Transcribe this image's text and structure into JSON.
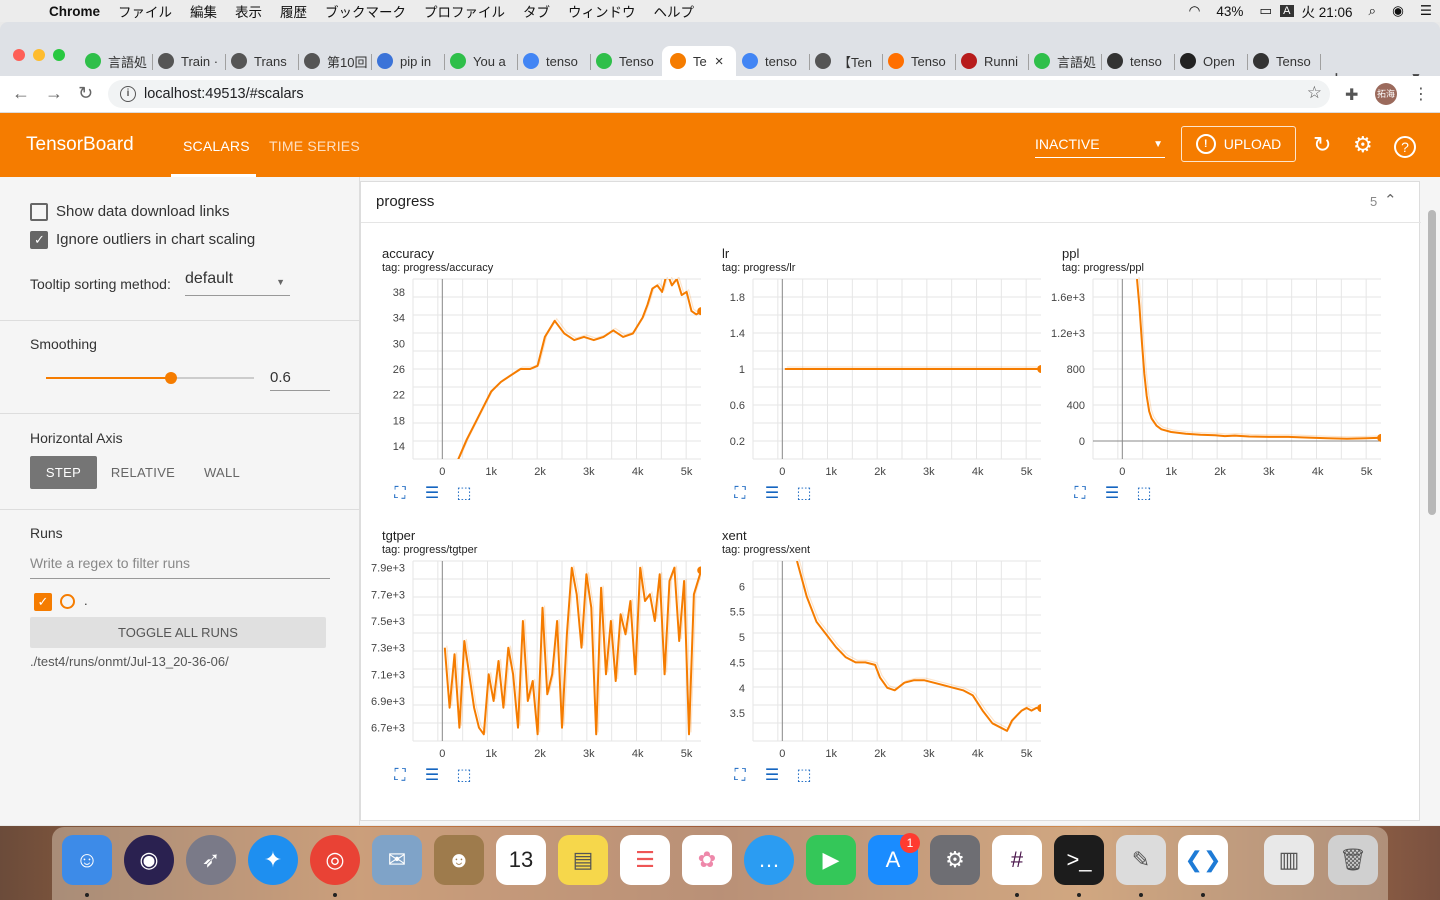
{
  "menubar": {
    "app": "Chrome",
    "items": [
      "ファイル",
      "編集",
      "表示",
      "履歴",
      "ブックマーク",
      "プロファイル",
      "タブ",
      "ウィンドウ",
      "ヘルプ"
    ],
    "battery": "43%",
    "input": "A",
    "clock": "火 21:06"
  },
  "tabs": [
    {
      "label": "言語処",
      "color": "#2fbf4a"
    },
    {
      "label": "Train ·",
      "color": "#555555"
    },
    {
      "label": "Trans",
      "color": "#555555"
    },
    {
      "label": "第10回",
      "color": "#555555"
    },
    {
      "label": "pip in",
      "color": "#3b73d8"
    },
    {
      "label": "You a",
      "color": "#2fbf4a"
    },
    {
      "label": "tenso",
      "color": "#4285f4"
    },
    {
      "label": "Tenso",
      "color": "#2fbf4a"
    },
    {
      "label": "Te",
      "color": "#f57c00",
      "active": true
    },
    {
      "label": "tenso",
      "color": "#4285f4"
    },
    {
      "label": "【Ten",
      "color": "#555555"
    },
    {
      "label": "Tenso",
      "color": "#ff6f00"
    },
    {
      "label": "Runni",
      "color": "#b71c1c"
    },
    {
      "label": "言語処",
      "color": "#2fbf4a"
    },
    {
      "label": "tenso",
      "color": "#333333"
    },
    {
      "label": "Open",
      "color": "#222222"
    },
    {
      "label": "Tenso",
      "color": "#333333"
    }
  ],
  "address": {
    "url": "localhost:49513/#scalars"
  },
  "profile": {
    "initials": "拓海"
  },
  "tensorboard": {
    "title": "TensorBoard",
    "nav": {
      "scalars": "SCALARS",
      "time_series": "TIME SERIES"
    },
    "inactive": "INACTIVE",
    "upload": "UPLOAD",
    "accent": "#f57c00"
  },
  "sidebar": {
    "show_download_links": "Show data download links",
    "ignore_outliers": "Ignore outliers in chart scaling",
    "tooltip_label": "Tooltip sorting method:",
    "tooltip_value": "default",
    "smoothing_label": "Smoothing",
    "smoothing_value": "0.6",
    "smoothing_fraction": 0.6,
    "horizontal_axis_label": "Horizontal Axis",
    "axis_step": "STEP",
    "axis_relative": "RELATIVE",
    "axis_wall": "WALL",
    "runs_label": "Runs",
    "runs_filter_placeholder": "Write a regex to filter runs",
    "run_name": ".",
    "toggle_all": "TOGGLE ALL RUNS",
    "run_path": "./test4/runs/onmt/Jul-13_20-36-06/"
  },
  "panel": {
    "title": "progress",
    "count": "5"
  },
  "chart_data": [
    {
      "type": "line",
      "name": "accuracy",
      "tag": "tag: progress/accuracy",
      "x_ticks": [
        "0",
        "1k",
        "2k",
        "3k",
        "4k",
        "5k"
      ],
      "x_tick_values": [
        0,
        1000,
        2000,
        3000,
        4000,
        5000
      ],
      "y_ticks": [
        "14",
        "18",
        "22",
        "26",
        "30",
        "34",
        "38"
      ],
      "y_tick_values": [
        14,
        18,
        22,
        26,
        30,
        34,
        38
      ],
      "xlim": [
        -600,
        5500
      ],
      "ylim": [
        12,
        40
      ],
      "grid": true,
      "x": [
        300,
        500,
        700,
        900,
        1000,
        1200,
        1400,
        1600,
        1800,
        1950,
        2100,
        2300,
        2500,
        2700,
        2900,
        3100,
        3300,
        3500,
        3700,
        3900,
        4100,
        4200,
        4300,
        4400,
        4500,
        4550,
        4600,
        4700,
        4800,
        4900,
        5000,
        5100,
        5200,
        5300
      ],
      "y": [
        11.5,
        15,
        18,
        21,
        22.5,
        24,
        25,
        26,
        26,
        26.5,
        31,
        33.5,
        31.5,
        30.5,
        31,
        30.5,
        31,
        32,
        31,
        31.5,
        34,
        36,
        38.5,
        39,
        38,
        39.5,
        41,
        39,
        40,
        37.5,
        38,
        35,
        34.5,
        35
      ]
    },
    {
      "type": "line",
      "name": "lr",
      "tag": "tag: progress/lr",
      "x_ticks": [
        "0",
        "1k",
        "2k",
        "3k",
        "4k",
        "5k"
      ],
      "x_tick_values": [
        0,
        1000,
        2000,
        3000,
        4000,
        5000
      ],
      "y_ticks": [
        "0.2",
        "0.6",
        "1",
        "1.4",
        "1.8"
      ],
      "y_tick_values": [
        0.2,
        0.6,
        1,
        1.4,
        1.8
      ],
      "xlim": [
        -600,
        5500
      ],
      "ylim": [
        0,
        2
      ],
      "grid": true,
      "x": [
        50,
        5300
      ],
      "y": [
        1,
        1
      ]
    },
    {
      "type": "line",
      "name": "ppl",
      "tag": "tag: progress/ppl",
      "x_ticks": [
        "0",
        "1k",
        "2k",
        "3k",
        "4k",
        "5k"
      ],
      "x_tick_values": [
        0,
        1000,
        2000,
        3000,
        4000,
        5000
      ],
      "y_ticks": [
        "0",
        "400",
        "800",
        "1.2e+3",
        "1.6e+3"
      ],
      "y_tick_values": [
        0,
        400,
        800,
        1200,
        1600
      ],
      "xlim": [
        -600,
        5500
      ],
      "ylim": [
        -200,
        1800
      ],
      "grid": true,
      "x": [
        300,
        350,
        400,
        450,
        500,
        550,
        600,
        700,
        800,
        1000,
        1300,
        1600,
        1900,
        2100,
        2300,
        2600,
        3000,
        3400,
        3800,
        4200,
        4600,
        5000,
        5300
      ],
      "y": [
        1800,
        1500,
        1100,
        750,
        500,
        330,
        250,
        170,
        130,
        100,
        80,
        70,
        65,
        55,
        60,
        50,
        45,
        45,
        38,
        30,
        25,
        30,
        35
      ]
    },
    {
      "type": "line",
      "name": "tgtper",
      "tag": "tag: progress/tgtper",
      "x_ticks": [
        "0",
        "1k",
        "2k",
        "3k",
        "4k",
        "5k"
      ],
      "x_tick_values": [
        0,
        1000,
        2000,
        3000,
        4000,
        5000
      ],
      "y_ticks": [
        "6.7e+3",
        "6.9e+3",
        "7.1e+3",
        "7.3e+3",
        "7.5e+3",
        "7.7e+3",
        "7.9e+3"
      ],
      "y_tick_values": [
        6700,
        6900,
        7100,
        7300,
        7500,
        7700,
        7900
      ],
      "xlim": [
        -600,
        5500
      ],
      "ylim": [
        6600,
        7950
      ],
      "grid": true,
      "x": [
        50,
        150,
        250,
        350,
        450,
        550,
        650,
        750,
        850,
        950,
        1050,
        1150,
        1250,
        1350,
        1450,
        1550,
        1650,
        1750,
        1850,
        1950,
        2050,
        2150,
        2250,
        2350,
        2450,
        2550,
        2650,
        2750,
        2850,
        2950,
        3050,
        3150,
        3250,
        3350,
        3450,
        3550,
        3650,
        3750,
        3850,
        3950,
        4050,
        4150,
        4250,
        4350,
        4450,
        4550,
        4650,
        4750,
        4850,
        4950,
        5050,
        5150,
        5300
      ],
      "y": [
        7300,
        6850,
        7250,
        6700,
        7350,
        7100,
        6850,
        6700,
        6650,
        7100,
        6900,
        7200,
        6850,
        7300,
        7100,
        6700,
        7500,
        6900,
        7050,
        6650,
        7600,
        6950,
        7100,
        7500,
        6700,
        7400,
        7900,
        7700,
        7300,
        7850,
        7600,
        6650,
        7750,
        7100,
        7500,
        7050,
        7550,
        7400,
        7650,
        7100,
        7900,
        7650,
        7700,
        7500,
        7850,
        7100,
        7800,
        7900,
        7350,
        7800,
        6650,
        7700,
        7880
      ]
    },
    {
      "type": "line",
      "name": "xent",
      "tag": "tag: progress/xent",
      "x_ticks": [
        "0",
        "1k",
        "2k",
        "3k",
        "4k",
        "5k"
      ],
      "x_tick_values": [
        0,
        1000,
        2000,
        3000,
        4000,
        5000
      ],
      "y_ticks": [
        "3.5",
        "4",
        "4.5",
        "5",
        "5.5",
        "6"
      ],
      "y_tick_values": [
        3.5,
        4,
        4.5,
        5,
        5.5,
        6
      ],
      "xlim": [
        -600,
        5500
      ],
      "ylim": [
        2.95,
        6.5
      ],
      "grid": true,
      "x": [
        300,
        500,
        700,
        900,
        1100,
        1300,
        1500,
        1700,
        1900,
        2000,
        2150,
        2300,
        2500,
        2700,
        2900,
        3100,
        3300,
        3500,
        3700,
        3900,
        4100,
        4300,
        4500,
        4600,
        4700,
        4800,
        4900,
        5000,
        5100,
        5200,
        5300
      ],
      "y": [
        6.5,
        5.8,
        5.3,
        5.05,
        4.8,
        4.6,
        4.5,
        4.5,
        4.45,
        4.2,
        4.0,
        3.95,
        4.1,
        4.15,
        4.15,
        4.1,
        4.05,
        4.0,
        3.95,
        3.85,
        3.55,
        3.3,
        3.2,
        3.15,
        3.35,
        3.45,
        3.55,
        3.6,
        3.55,
        3.6,
        3.6
      ]
    }
  ]
}
